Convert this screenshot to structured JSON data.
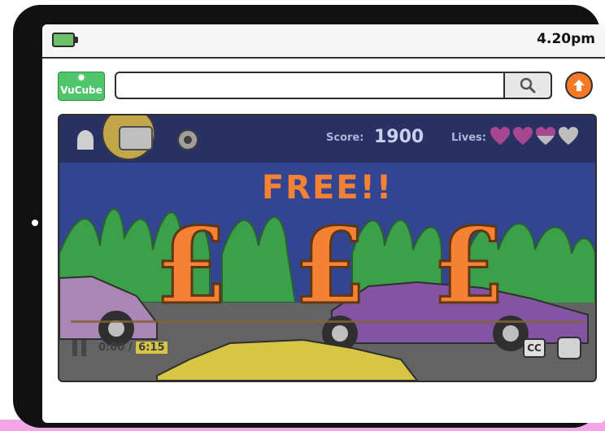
{
  "device": {
    "clock": "4.20pm"
  },
  "browser": {
    "logo_text": "VuCube",
    "search": {
      "value": "",
      "placeholder": ""
    }
  },
  "game": {
    "score_label": "Score:",
    "score_value": "1900",
    "lives_label": "Lives:",
    "lives_total": 4,
    "lives_remaining_full": 2,
    "headline": "FREE!!",
    "prize_symbols": [
      "£",
      "£",
      "£"
    ]
  },
  "player": {
    "elapsed": "0:00",
    "duration": "6:15",
    "progress_fraction": 0.0,
    "captions_label": "CC"
  },
  "colors": {
    "accent_orange": "#f47a28",
    "logo_green": "#4fc66b",
    "heart_pink": "#a13c8a",
    "heart_grey": "#b9b9b9"
  }
}
